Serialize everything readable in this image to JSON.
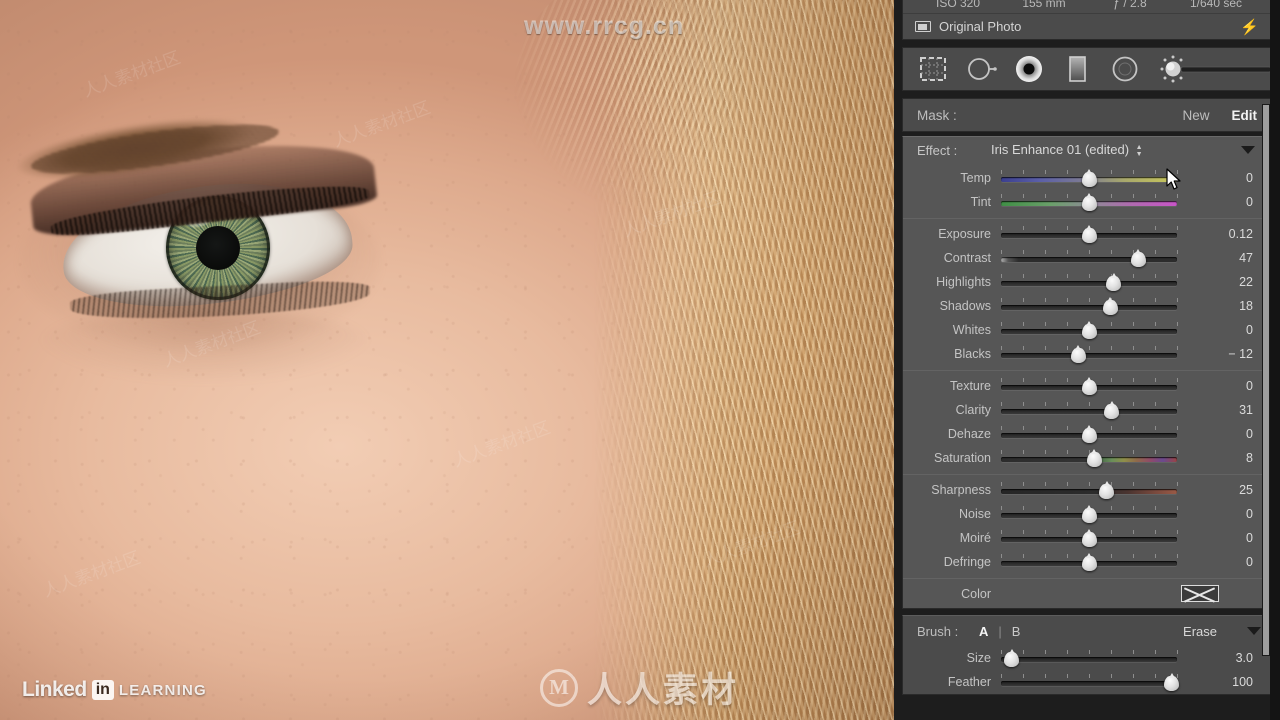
{
  "photo": {
    "alt_description": "Close-up portrait of a woman's green eye, eyebrow and cheek with blonde hair on the right",
    "watermarks": {
      "url": "www.rrcg.cn",
      "linkedin_word": "Linked",
      "linkedin_badge": "in",
      "linkedin_learning": "LEARNING",
      "center_logo_glyph": "M",
      "center_text": "人人素材",
      "diagonal_tile": "人人素材社区"
    }
  },
  "panel": {
    "exif": {
      "iso": "ISO 320",
      "focal_length": "155 mm",
      "aperture": "ƒ / 2.8",
      "shutter": "1/640 sec"
    },
    "original_photo": {
      "label": "Original Photo",
      "icon": "photo-frame-icon",
      "bolt_icon": "lightning-bolt-icon"
    },
    "tools": [
      {
        "name": "crop-overlay-tool",
        "selected": false
      },
      {
        "name": "spot-removal-tool",
        "selected": false
      },
      {
        "name": "red-eye-correction-tool",
        "selected": true
      },
      {
        "name": "graduated-filter-tool",
        "selected": false
      },
      {
        "name": "radial-filter-tool",
        "selected": false
      },
      {
        "name": "adjustment-brush-tool",
        "selected": false
      }
    ],
    "mask": {
      "label": "Mask :",
      "new": "New",
      "edit": "Edit"
    },
    "effect": {
      "label": "Effect :",
      "value": "Iris Enhance 01 (edited)"
    },
    "slider_groups": [
      {
        "name": "white-balance",
        "sliders": [
          {
            "label": "Temp",
            "value": "0",
            "pos": 50,
            "track": "temp"
          },
          {
            "label": "Tint",
            "value": "0",
            "pos": 50,
            "track": "tint"
          }
        ]
      },
      {
        "name": "tone",
        "sliders": [
          {
            "label": "Exposure",
            "value": "0.12",
            "pos": 50,
            "track": "plain"
          },
          {
            "label": "Contrast",
            "value": "47",
            "pos": 78,
            "track": "hotleft"
          },
          {
            "label": "Highlights",
            "value": "22",
            "pos": 64,
            "track": "plain"
          },
          {
            "label": "Shadows",
            "value": "18",
            "pos": 62,
            "track": "plain"
          },
          {
            "label": "Whites",
            "value": "0",
            "pos": 50,
            "track": "plain"
          },
          {
            "label": "Blacks",
            "value": "− 12",
            "pos": 44,
            "track": "plain"
          }
        ]
      },
      {
        "name": "presence",
        "sliders": [
          {
            "label": "Texture",
            "value": "0",
            "pos": 50,
            "track": "plain"
          },
          {
            "label": "Clarity",
            "value": "31",
            "pos": 63,
            "track": "plain"
          },
          {
            "label": "Dehaze",
            "value": "0",
            "pos": 50,
            "track": "plain"
          },
          {
            "label": "Saturation",
            "value": "8",
            "pos": 53,
            "track": "sat"
          }
        ]
      },
      {
        "name": "detail",
        "sliders": [
          {
            "label": "Sharpness",
            "value": "25",
            "pos": 60,
            "track": "sharp"
          },
          {
            "label": "Noise",
            "value": "0",
            "pos": 50,
            "track": "plain"
          },
          {
            "label": "Moiré",
            "value": "0",
            "pos": 50,
            "track": "plain"
          },
          {
            "label": "Defringe",
            "value": "0",
            "pos": 50,
            "track": "plain"
          }
        ]
      }
    ],
    "color": {
      "label": "Color",
      "swatch": "none"
    },
    "brush": {
      "label": "Brush :",
      "a": "A",
      "separator": "|",
      "b": "B",
      "erase": "Erase",
      "size": {
        "label": "Size",
        "value": "3.0",
        "pos": 6
      },
      "feather": {
        "label": "Feather",
        "value": "100",
        "pos": 97
      }
    }
  }
}
